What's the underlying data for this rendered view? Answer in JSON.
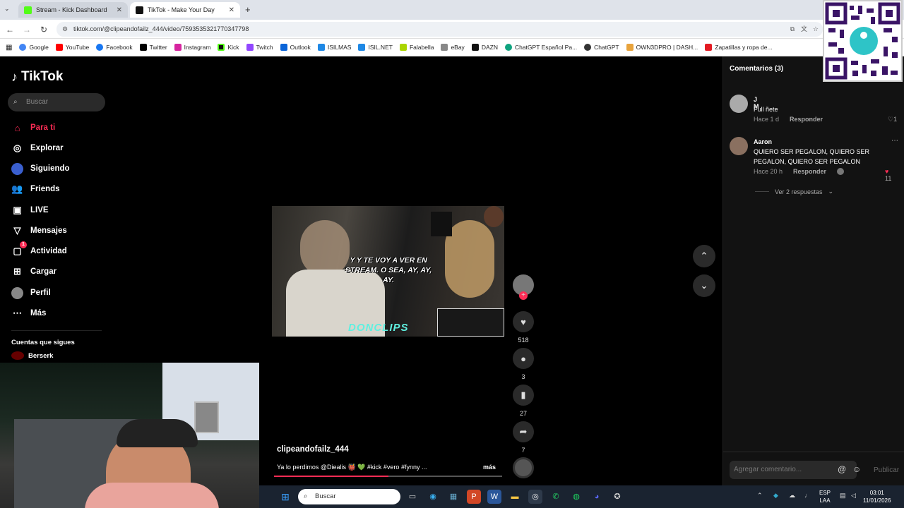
{
  "browser": {
    "tabs": [
      {
        "label": "Stream - Kick Dashboard",
        "active": false
      },
      {
        "label": "TikTok - Make Your Day",
        "active": true
      }
    ],
    "new_tab": "+",
    "url": "tiktok.com/@clipeandofailz_444/video/7593535321770347798",
    "bookmarks": [
      "Google",
      "YouTube",
      "Facebook",
      "Twitter",
      "Instagram",
      "Kick",
      "Twitch",
      "Outlook",
      "ISILMAS",
      "ISIL.NET",
      "Falabella",
      "eBay",
      "DAZN",
      "ChatGPT Español Pa...",
      "ChatGPT",
      "OWN3DPRO | DASH...",
      "Zapatillas y ropa de..."
    ]
  },
  "tiktok": {
    "logo": "TikTok",
    "search_placeholder": "Buscar",
    "nav": [
      {
        "label": "Para ti",
        "icon": "home-icon",
        "active": true
      },
      {
        "label": "Explorar",
        "icon": "compass-icon"
      },
      {
        "label": "Siguiendo",
        "icon": "following-avatar-icon"
      },
      {
        "label": "Friends",
        "icon": "friends-icon"
      },
      {
        "label": "LIVE",
        "icon": "live-icon"
      },
      {
        "label": "Mensajes",
        "icon": "send-icon"
      },
      {
        "label": "Actividad",
        "icon": "activity-icon",
        "badge": "1"
      },
      {
        "label": "Cargar",
        "icon": "upload-icon"
      },
      {
        "label": "Perfil",
        "icon": "profile-avatar-icon"
      },
      {
        "label": "Más",
        "icon": "more-icon"
      }
    ],
    "following_title": "Cuentas que sigues",
    "following": [
      "Berserk"
    ],
    "video": {
      "subtitle": "Y Y TE VOY A VER EN STREAM. O SEA, AY, AY, AY.",
      "watermark": "DONCLIPS",
      "author": "clipeandofailz_444",
      "caption": "Ya lo perdimos @Diealis 👹 💚 #kick #vero #fynny ...",
      "more": "más",
      "progress": 0.5
    },
    "actions": {
      "likes": "518",
      "comments": "3",
      "saves": "27",
      "shares": "7"
    }
  },
  "comments_panel": {
    "title": "Comentarios",
    "count": "(3)",
    "items": [
      {
        "name": "J M",
        "text": "Full ñete",
        "time": "Hace 1 d",
        "reply": "Responder",
        "likes": "1"
      },
      {
        "name": "Aaron",
        "text": "QUIERO SER PEGALON, QUIERO SER PEGALON, QUIERO SER PEGALON",
        "time": "Hace 20 h",
        "reply": "Responder",
        "likes": "11"
      }
    ],
    "view_replies": "Ver 2 respuestas",
    "input_placeholder": "Agregar comentario...",
    "publish": "Publicar"
  },
  "taskbar": {
    "search": "Buscar",
    "lang_top": "ESP",
    "lang_bottom": "LAA",
    "time": "03:01",
    "date": "11/01/2026"
  },
  "colors": {
    "accent": "#fe2c55",
    "kick": "#53fc18",
    "taskbar": "#1a2330"
  }
}
